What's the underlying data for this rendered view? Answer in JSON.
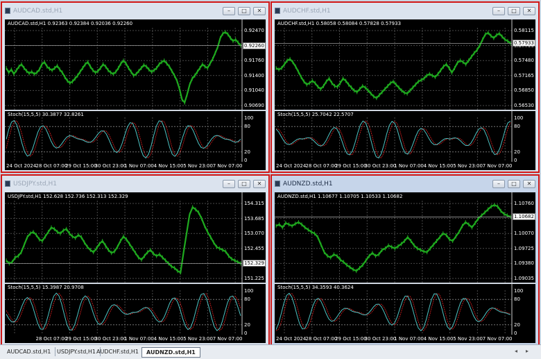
{
  "windows": [
    {
      "title": "AUDCAD.std,H1",
      "info": "AUDCAD.std,H1  0.92363 0.92384 0.92036 0.92260",
      "yticks": [
        "0.92470",
        "0.92110",
        "0.91760",
        "0.91400",
        "0.91040",
        "0.90690"
      ],
      "price": "0.92260",
      "stoch": "Stoch(15,5,5) 30.3877 32.8261",
      "stoch_ticks": [
        "100",
        "80",
        "20",
        "0"
      ],
      "xticks": [
        "24 Oct 2024",
        "28 Oct 07:00",
        "29 Oct 15:00",
        "30 Oct 23:00",
        "1 Nov 07:00",
        "4 Nov 15:00",
        "5 Nov 23:00",
        "7 Nov 07:00"
      ],
      "active": false,
      "series": [
        0.5,
        0.44,
        0.48,
        0.42,
        0.47,
        0.52,
        0.55,
        0.5,
        0.46,
        0.43,
        0.45,
        0.42,
        0.44,
        0.48,
        0.55,
        0.58,
        0.52,
        0.49,
        0.47,
        0.5,
        0.53,
        0.48,
        0.44,
        0.38,
        0.33,
        0.3,
        0.32,
        0.36,
        0.4,
        0.45,
        0.5,
        0.55,
        0.58,
        0.52,
        0.47,
        0.44,
        0.46,
        0.5,
        0.55,
        0.52,
        0.47,
        0.44,
        0.42,
        0.45,
        0.5,
        0.56,
        0.6,
        0.56,
        0.5,
        0.45,
        0.4,
        0.42,
        0.46,
        0.5,
        0.54,
        0.52,
        0.48,
        0.45,
        0.47,
        0.5,
        0.55,
        0.58,
        0.6,
        0.56,
        0.52,
        0.46,
        0.4,
        0.33,
        0.22,
        0.08,
        0.04,
        0.15,
        0.28,
        0.36,
        0.4,
        0.45,
        0.5,
        0.55,
        0.52,
        0.5,
        0.56,
        0.62,
        0.7,
        0.78,
        0.9,
        0.96,
        0.98,
        0.95,
        0.9,
        0.86,
        0.88,
        0.84,
        0.8
      ]
    },
    {
      "title": "AUDCHF.std,H1",
      "info": "AUDCHF.std,H1  0.58058 0.58084 0.57828 0.57933",
      "yticks": [
        "0.58115",
        "0.57790",
        "0.57480",
        "0.57165",
        "0.56850",
        "0.56530"
      ],
      "price": "0.57933",
      "stoch": "Stoch(15,5,5) 25.7042 22.5707",
      "stoch_ticks": [
        "100",
        "80",
        "20",
        "0"
      ],
      "xticks": [
        "24 Oct 2024",
        "28 Oct 07:00",
        "29 Oct 15:00",
        "30 Oct 23:00",
        "1 Nov 07:00",
        "4 Nov 15:00",
        "5 Nov 23:00",
        "7 Nov 07:00"
      ],
      "active": false,
      "series": [
        0.5,
        0.48,
        0.5,
        0.55,
        0.6,
        0.62,
        0.58,
        0.52,
        0.45,
        0.38,
        0.32,
        0.28,
        0.3,
        0.33,
        0.3,
        0.25,
        0.22,
        0.26,
        0.32,
        0.36,
        0.3,
        0.26,
        0.25,
        0.3,
        0.36,
        0.33,
        0.28,
        0.24,
        0.2,
        0.18,
        0.22,
        0.26,
        0.24,
        0.2,
        0.16,
        0.12,
        0.1,
        0.14,
        0.18,
        0.22,
        0.26,
        0.3,
        0.32,
        0.28,
        0.24,
        0.2,
        0.17,
        0.16,
        0.2,
        0.24,
        0.28,
        0.32,
        0.34,
        0.36,
        0.4,
        0.42,
        0.4,
        0.38,
        0.42,
        0.47,
        0.52,
        0.55,
        0.5,
        0.44,
        0.5,
        0.57,
        0.6,
        0.58,
        0.55,
        0.6,
        0.65,
        0.7,
        0.74,
        0.8,
        0.88,
        0.95,
        0.97,
        0.93,
        0.9,
        0.94,
        0.96,
        0.92,
        0.88,
        0.86,
        0.83
      ]
    },
    {
      "title": "USDJPY.std,H1",
      "info": "USDJPY.std,H1  152.628 152.736 152.313 152.329",
      "yticks": [
        "154.315",
        "153.685",
        "153.070",
        "152.455",
        "151.840",
        "151.225"
      ],
      "price": "152.329",
      "stoch": "Stoch(15,5,5) 15.3987 20.9708",
      "stoch_ticks": [
        "100",
        "80",
        "20",
        "0"
      ],
      "xticks": [
        "28 Oct 07:00",
        "29 Oct 15:00",
        "30 Oct 23:00",
        "1 Nov 07:00",
        "4 Nov 15:00",
        "5 Nov 23:00",
        "7 Nov 07:00"
      ],
      "active": false,
      "series": [
        0.24,
        0.2,
        0.22,
        0.28,
        0.3,
        0.35,
        0.45,
        0.55,
        0.6,
        0.62,
        0.58,
        0.52,
        0.5,
        0.56,
        0.62,
        0.68,
        0.66,
        0.62,
        0.6,
        0.64,
        0.66,
        0.6,
        0.56,
        0.54,
        0.58,
        0.55,
        0.48,
        0.42,
        0.38,
        0.35,
        0.4,
        0.46,
        0.5,
        0.44,
        0.38,
        0.34,
        0.36,
        0.42,
        0.5,
        0.56,
        0.52,
        0.46,
        0.4,
        0.34,
        0.28,
        0.25,
        0.3,
        0.35,
        0.38,
        0.33,
        0.3,
        0.32,
        0.28,
        0.24,
        0.2,
        0.16,
        0.14,
        0.1,
        0.08,
        0.35,
        0.6,
        0.85,
        0.95,
        0.92,
        0.88,
        0.8,
        0.7,
        0.62,
        0.55,
        0.48,
        0.42,
        0.4,
        0.38,
        0.36,
        0.3,
        0.26,
        0.24,
        0.22,
        0.2
      ]
    },
    {
      "title": "AUDNZD.std,H1",
      "info": "AUDNZD.std,H1  1.10677 1.10705 1.10533 1.10682",
      "yticks": [
        "1.10760",
        "1.10415",
        "1.10070",
        "1.09725",
        "1.09380",
        "1.09035"
      ],
      "price": "1.10682",
      "stoch": "Stoch(15,5,5) 34.3593 40.3624",
      "stoch_ticks": [
        "100",
        "80",
        "20",
        "0"
      ],
      "xticks": [
        "24 Oct 2024",
        "28 Oct 07:00",
        "29 Oct 15:00",
        "30 Oct 23:00",
        "1 Nov 07:00",
        "4 Nov 15:00",
        "5 Nov 23:00",
        "7 Nov 07:00"
      ],
      "active": true,
      "series": [
        0.7,
        0.72,
        0.68,
        0.74,
        0.72,
        0.7,
        0.73,
        0.75,
        0.72,
        0.68,
        0.65,
        0.62,
        0.6,
        0.55,
        0.45,
        0.35,
        0.3,
        0.28,
        0.32,
        0.3,
        0.25,
        0.22,
        0.18,
        0.15,
        0.12,
        0.1,
        0.14,
        0.18,
        0.24,
        0.3,
        0.34,
        0.3,
        0.32,
        0.38,
        0.4,
        0.44,
        0.42,
        0.4,
        0.43,
        0.46,
        0.5,
        0.55,
        0.5,
        0.44,
        0.4,
        0.38,
        0.36,
        0.35,
        0.4,
        0.45,
        0.5,
        0.55,
        0.6,
        0.58,
        0.52,
        0.5,
        0.56,
        0.62,
        0.7,
        0.75,
        0.72,
        0.68,
        0.74,
        0.8,
        0.84,
        0.88,
        0.92,
        0.96,
        0.98,
        0.96,
        0.9,
        0.86,
        0.84,
        0.82
      ]
    }
  ],
  "tabs": [
    "AUDCAD.std,H1",
    "USDJPY.std,H1",
    "AUDCHF.std,H1",
    "AUDNZD.std,H1"
  ],
  "active_tab": 3,
  "colors": {
    "price": "#1faa1f",
    "stoch_main": "#4fc3c3",
    "stoch_signal": "#e02020",
    "frame": "#d11616"
  }
}
